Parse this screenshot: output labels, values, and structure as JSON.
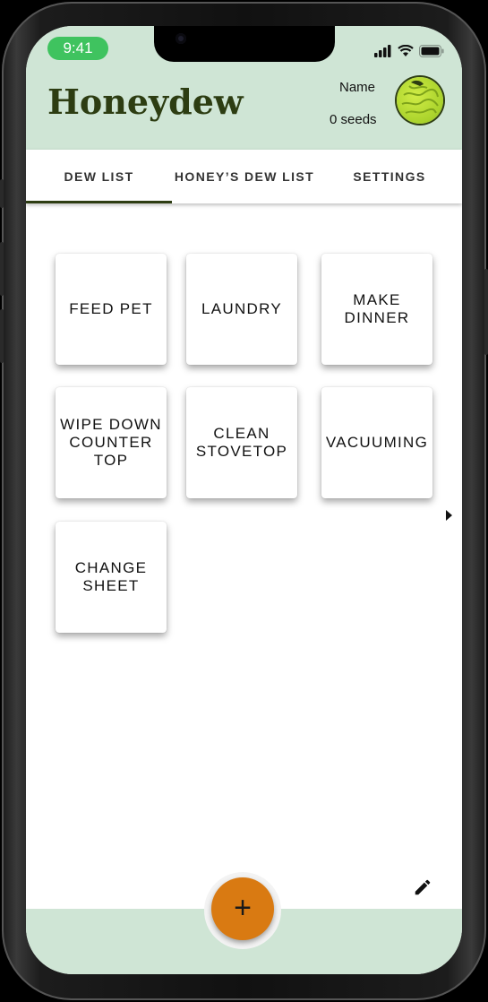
{
  "status_bar": {
    "time": "9:41"
  },
  "header": {
    "brand": "Honeydew",
    "user_name": "Name",
    "seeds": "0 seeds",
    "avatar_icon": "melon-avatar-icon"
  },
  "tabs": [
    {
      "label": "DEW LIST",
      "active": true
    },
    {
      "label": "HONEY’S DEW LIST",
      "active": false
    },
    {
      "label": "SETTINGS",
      "active": false
    }
  ],
  "chores": [
    {
      "label": "FEED PET"
    },
    {
      "label": "LAUNDRY"
    },
    {
      "label": "MAKE DINNER"
    },
    {
      "label": "WIPE DOWN COUNTER TOP"
    },
    {
      "label": "CLEAN STOVETOP"
    },
    {
      "label": "VACUUMING"
    },
    {
      "label": "CHANGE SHEET"
    }
  ],
  "fab": {
    "icon": "plus-icon",
    "label": "+"
  },
  "edit": {
    "icon": "pencil-icon"
  },
  "colors": {
    "header_bg": "#cfe5d5",
    "brand_text": "#2d3d12",
    "fab": "#d97a12",
    "time_pill": "#3fc35f"
  }
}
